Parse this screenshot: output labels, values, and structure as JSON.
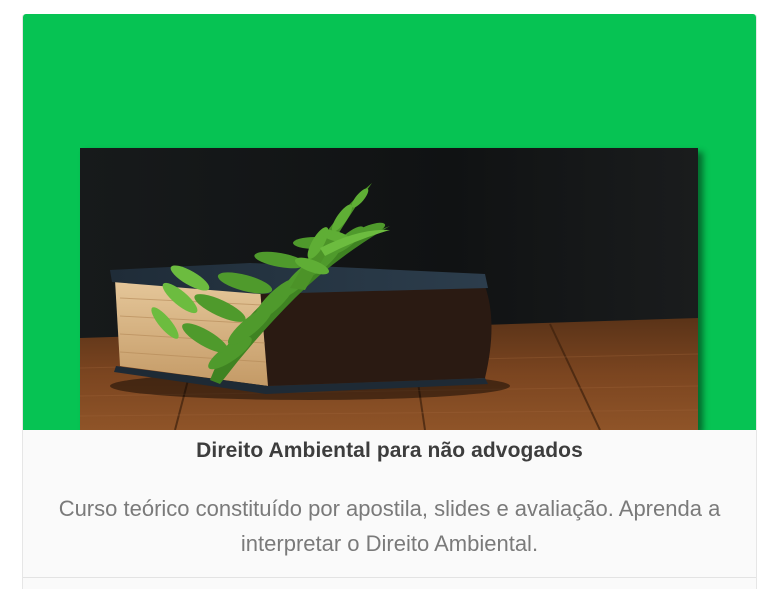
{
  "course_card": {
    "banner_color": "#06c353",
    "image_subject": "book-with-fern-image",
    "title": "Direito Ambiental para não advogados",
    "description": "Curso teórico constituído por apostila, slides e avaliação. Aprenda a interpretar o Direito Ambiental."
  }
}
